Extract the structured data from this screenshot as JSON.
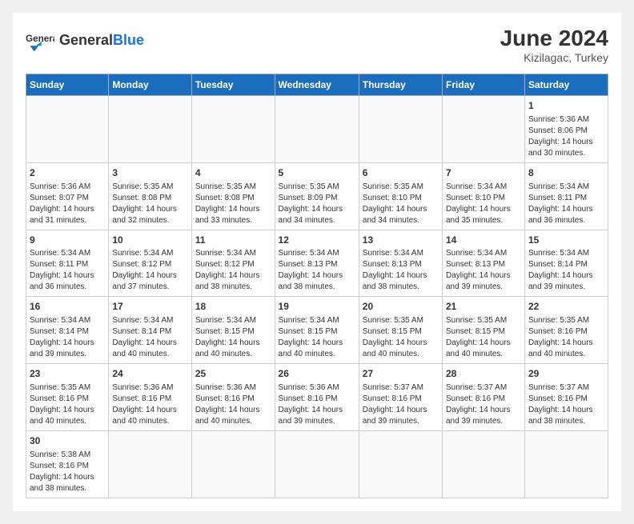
{
  "header": {
    "logo_general": "General",
    "logo_blue": "Blue",
    "month_year": "June 2024",
    "location": "Kizilagac, Turkey"
  },
  "weekdays": [
    "Sunday",
    "Monday",
    "Tuesday",
    "Wednesday",
    "Thursday",
    "Friday",
    "Saturday"
  ],
  "days": [
    {
      "num": "",
      "info": ""
    },
    {
      "num": "",
      "info": ""
    },
    {
      "num": "",
      "info": ""
    },
    {
      "num": "",
      "info": ""
    },
    {
      "num": "",
      "info": ""
    },
    {
      "num": "",
      "info": ""
    },
    {
      "num": "1",
      "info": "Sunrise: 5:36 AM\nSunset: 8:06 PM\nDaylight: 14 hours and 30 minutes."
    },
    {
      "num": "2",
      "info": "Sunrise: 5:36 AM\nSunset: 8:07 PM\nDaylight: 14 hours and 31 minutes."
    },
    {
      "num": "3",
      "info": "Sunrise: 5:35 AM\nSunset: 8:08 PM\nDaylight: 14 hours and 32 minutes."
    },
    {
      "num": "4",
      "info": "Sunrise: 5:35 AM\nSunset: 8:08 PM\nDaylight: 14 hours and 33 minutes."
    },
    {
      "num": "5",
      "info": "Sunrise: 5:35 AM\nSunset: 8:09 PM\nDaylight: 14 hours and 34 minutes."
    },
    {
      "num": "6",
      "info": "Sunrise: 5:35 AM\nSunset: 8:10 PM\nDaylight: 14 hours and 34 minutes."
    },
    {
      "num": "7",
      "info": "Sunrise: 5:34 AM\nSunset: 8:10 PM\nDaylight: 14 hours and 35 minutes."
    },
    {
      "num": "8",
      "info": "Sunrise: 5:34 AM\nSunset: 8:11 PM\nDaylight: 14 hours and 36 minutes."
    },
    {
      "num": "9",
      "info": "Sunrise: 5:34 AM\nSunset: 8:11 PM\nDaylight: 14 hours and 36 minutes."
    },
    {
      "num": "10",
      "info": "Sunrise: 5:34 AM\nSunset: 8:12 PM\nDaylight: 14 hours and 37 minutes."
    },
    {
      "num": "11",
      "info": "Sunrise: 5:34 AM\nSunset: 8:12 PM\nDaylight: 14 hours and 38 minutes."
    },
    {
      "num": "12",
      "info": "Sunrise: 5:34 AM\nSunset: 8:13 PM\nDaylight: 14 hours and 38 minutes."
    },
    {
      "num": "13",
      "info": "Sunrise: 5:34 AM\nSunset: 8:13 PM\nDaylight: 14 hours and 38 minutes."
    },
    {
      "num": "14",
      "info": "Sunrise: 5:34 AM\nSunset: 8:13 PM\nDaylight: 14 hours and 39 minutes."
    },
    {
      "num": "15",
      "info": "Sunrise: 5:34 AM\nSunset: 8:14 PM\nDaylight: 14 hours and 39 minutes."
    },
    {
      "num": "16",
      "info": "Sunrise: 5:34 AM\nSunset: 8:14 PM\nDaylight: 14 hours and 39 minutes."
    },
    {
      "num": "17",
      "info": "Sunrise: 5:34 AM\nSunset: 8:14 PM\nDaylight: 14 hours and 40 minutes."
    },
    {
      "num": "18",
      "info": "Sunrise: 5:34 AM\nSunset: 8:15 PM\nDaylight: 14 hours and 40 minutes."
    },
    {
      "num": "19",
      "info": "Sunrise: 5:34 AM\nSunset: 8:15 PM\nDaylight: 14 hours and 40 minutes."
    },
    {
      "num": "20",
      "info": "Sunrise: 5:35 AM\nSunset: 8:15 PM\nDaylight: 14 hours and 40 minutes."
    },
    {
      "num": "21",
      "info": "Sunrise: 5:35 AM\nSunset: 8:15 PM\nDaylight: 14 hours and 40 minutes."
    },
    {
      "num": "22",
      "info": "Sunrise: 5:35 AM\nSunset: 8:16 PM\nDaylight: 14 hours and 40 minutes."
    },
    {
      "num": "23",
      "info": "Sunrise: 5:35 AM\nSunset: 8:16 PM\nDaylight: 14 hours and 40 minutes."
    },
    {
      "num": "24",
      "info": "Sunrise: 5:36 AM\nSunset: 8:16 PM\nDaylight: 14 hours and 40 minutes."
    },
    {
      "num": "25",
      "info": "Sunrise: 5:36 AM\nSunset: 8:16 PM\nDaylight: 14 hours and 40 minutes."
    },
    {
      "num": "26",
      "info": "Sunrise: 5:36 AM\nSunset: 8:16 PM\nDaylight: 14 hours and 39 minutes."
    },
    {
      "num": "27",
      "info": "Sunrise: 5:37 AM\nSunset: 8:16 PM\nDaylight: 14 hours and 39 minutes."
    },
    {
      "num": "28",
      "info": "Sunrise: 5:37 AM\nSunset: 8:16 PM\nDaylight: 14 hours and 39 minutes."
    },
    {
      "num": "29",
      "info": "Sunrise: 5:37 AM\nSunset: 8:16 PM\nDaylight: 14 hours and 38 minutes."
    },
    {
      "num": "30",
      "info": "Sunrise: 5:38 AM\nSunset: 8:16 PM\nDaylight: 14 hours and 38 minutes."
    },
    {
      "num": "",
      "info": ""
    },
    {
      "num": "",
      "info": ""
    },
    {
      "num": "",
      "info": ""
    },
    {
      "num": "",
      "info": ""
    },
    {
      "num": "",
      "info": ""
    },
    {
      "num": "",
      "info": ""
    }
  ]
}
